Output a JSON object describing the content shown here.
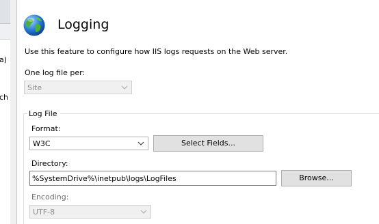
{
  "left_panel": {
    "fragments": [
      "a)",
      "ch"
    ]
  },
  "header": {
    "icon": "globe-icon",
    "title": "Logging"
  },
  "description": "Use this feature to configure how IIS logs requests on the Web server.",
  "log_per": {
    "label": "One log file per:",
    "value": "Site"
  },
  "log_file": {
    "group_label": "Log File",
    "format_label": "Format:",
    "format_value": "W3C",
    "select_fields_label": "Select Fields...",
    "directory_label": "Directory:",
    "directory_value": "%SystemDrive%\\inetpub\\logs\\LogFiles",
    "browse_label": "Browse...",
    "encoding_label": "Encoding:",
    "encoding_value": "UTF-8"
  },
  "colors": {
    "disabled_text": "#8c8c8c",
    "button_bg": "#e1e1e1",
    "border": "#abadb3"
  }
}
